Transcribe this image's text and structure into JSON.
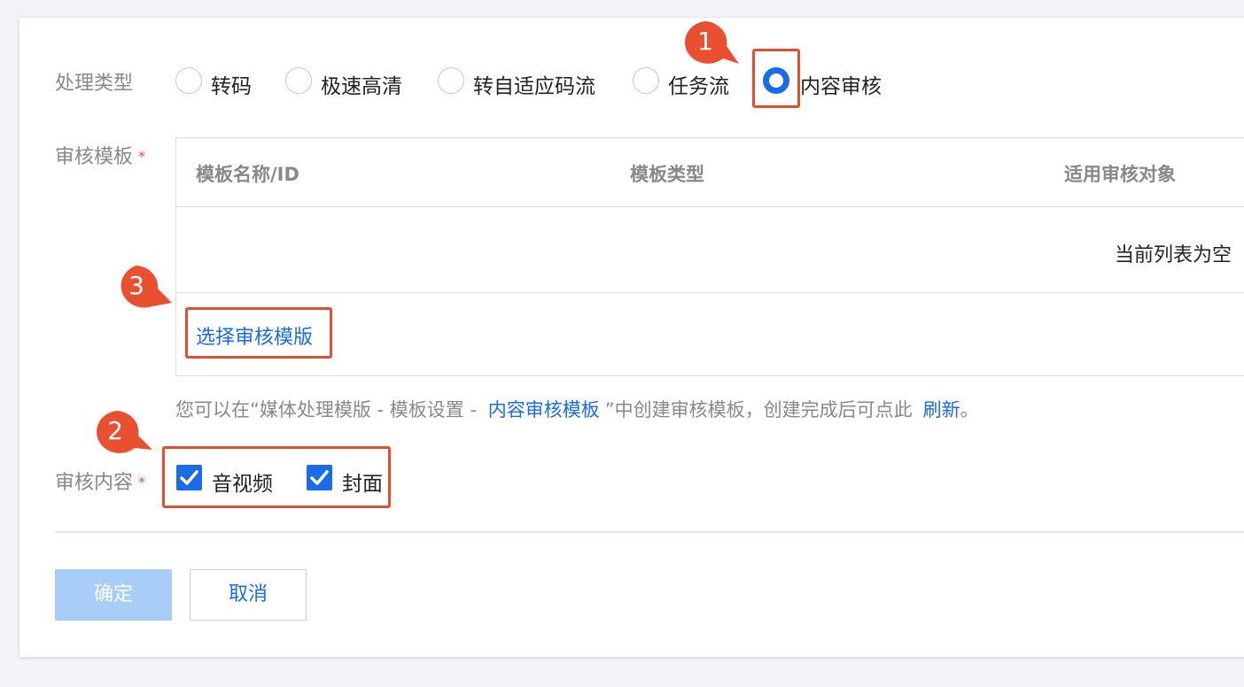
{
  "form": {
    "processing_type_label": "处理类型",
    "options": [
      {
        "label": "转码",
        "checked": false
      },
      {
        "label": "极速高清",
        "checked": false
      },
      {
        "label": "转自适应码流",
        "checked": false
      },
      {
        "label": "任务流",
        "checked": false
      },
      {
        "label": "内容审核",
        "checked": true
      }
    ],
    "template_label": "审核模板",
    "required_mark": "*",
    "table": {
      "columns": [
        "模板名称/ID",
        "模板类型",
        "适用审核对象"
      ],
      "empty_text": "当前列表为空"
    },
    "select_template_link": "选择审核模版",
    "hint": {
      "prefix": "您可以在“媒体处理模版 - 模板设置 - ",
      "link": "内容审核模板",
      "middle": "”中创建审核模板，创建完成后可点此",
      "refresh_link": "刷新",
      "suffix": "。"
    },
    "content_label": "审核内容",
    "content_options": [
      {
        "label": "音视频",
        "checked": true
      },
      {
        "label": "封面",
        "checked": true
      }
    ],
    "confirm_button": "确定",
    "cancel_button": "取消"
  },
  "annotations": {
    "badge_1": "1",
    "badge_2": "2",
    "badge_3": "3",
    "color": "#e9502f"
  },
  "colors": {
    "accent": "#1a6be8",
    "primary_disabled": "#a8cdf8",
    "highlight": "#e0502f"
  }
}
